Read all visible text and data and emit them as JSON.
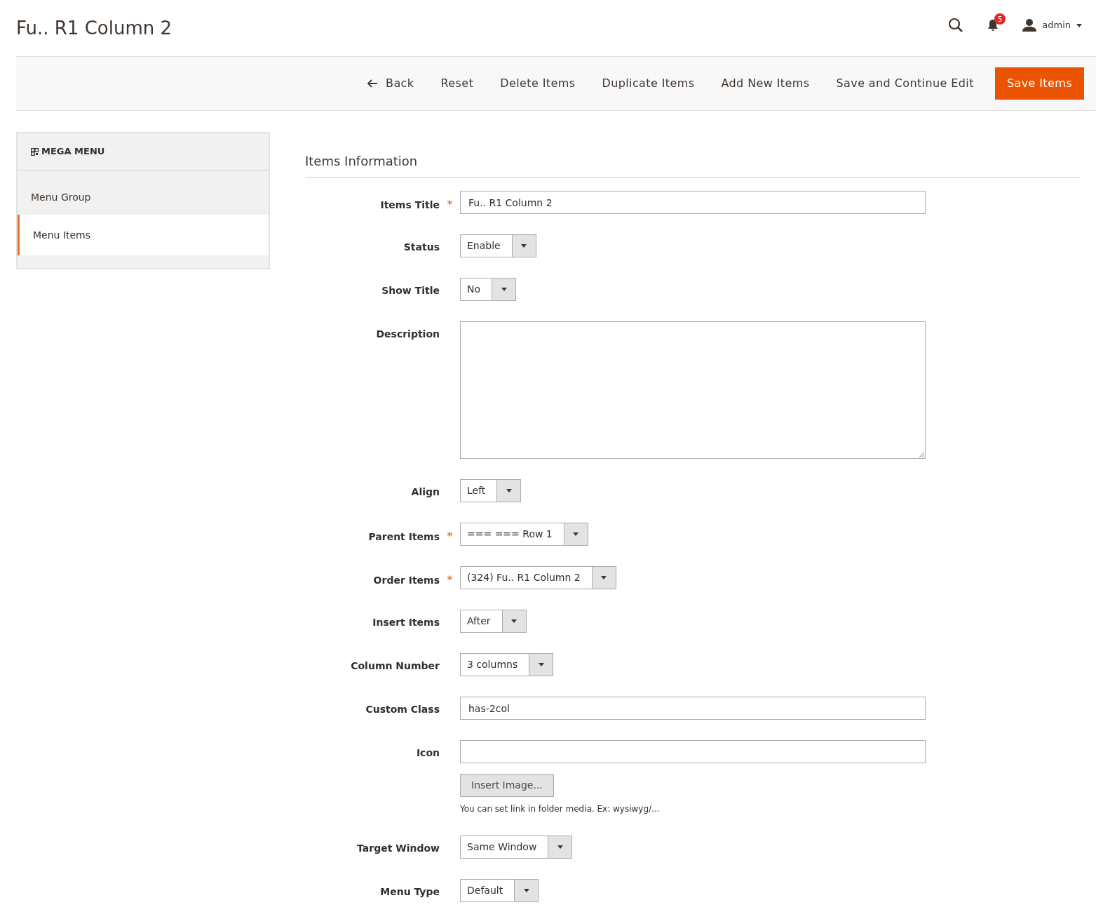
{
  "page_title": "Fu.. R1 Column 2",
  "header": {
    "notifications": "5",
    "user": "admin"
  },
  "toolbar": {
    "buttons": [
      {
        "label": "Back",
        "kind": "back"
      },
      {
        "label": "Reset",
        "kind": "plain"
      },
      {
        "label": "Delete Items",
        "kind": "plain"
      },
      {
        "label": "Duplicate Items",
        "kind": "plain"
      },
      {
        "label": "Add New Items",
        "kind": "plain"
      },
      {
        "label": "Save and Continue Edit",
        "kind": "plain"
      },
      {
        "label": "Save Items",
        "kind": "primary"
      }
    ]
  },
  "sidebar": {
    "title": "MEGA MENU",
    "items": [
      {
        "label": "Menu Group",
        "selected": false
      },
      {
        "label": "Menu Items",
        "selected": true
      }
    ]
  },
  "section_title": "Items Information",
  "fields": [
    {
      "label": "Items Title",
      "required_mark": "*",
      "kind": "text",
      "value": "Fu.. R1 Column 2"
    },
    {
      "label": "Status",
      "kind": "select",
      "value": "Enable"
    },
    {
      "label": "Show Title",
      "kind": "select",
      "value": "No"
    },
    {
      "label": "Description",
      "kind": "textarea"
    },
    {
      "label": "Align",
      "kind": "select",
      "value": "Left"
    },
    {
      "label": "Parent Items",
      "required_mark": "*",
      "kind": "select",
      "value": "=== === Row 1"
    },
    {
      "label": "Order Items",
      "required_mark": "*",
      "kind": "select",
      "value": "(324) Fu.. R1 Column 2"
    },
    {
      "label": "Insert Items",
      "kind": "select",
      "value": "After"
    },
    {
      "label": "Column Number",
      "kind": "select",
      "value": "3 columns"
    },
    {
      "label": "Custom Class",
      "kind": "text",
      "value": "has-2col"
    },
    {
      "label": "Icon",
      "kind": "image",
      "button": "Insert Image...",
      "note": "You can set link in folder media. Ex: wysiwyg/..."
    },
    {
      "label": "Target Window",
      "kind": "select",
      "value": "Same Window"
    },
    {
      "label": "Menu Type",
      "kind": "select",
      "value": "Default"
    }
  ]
}
